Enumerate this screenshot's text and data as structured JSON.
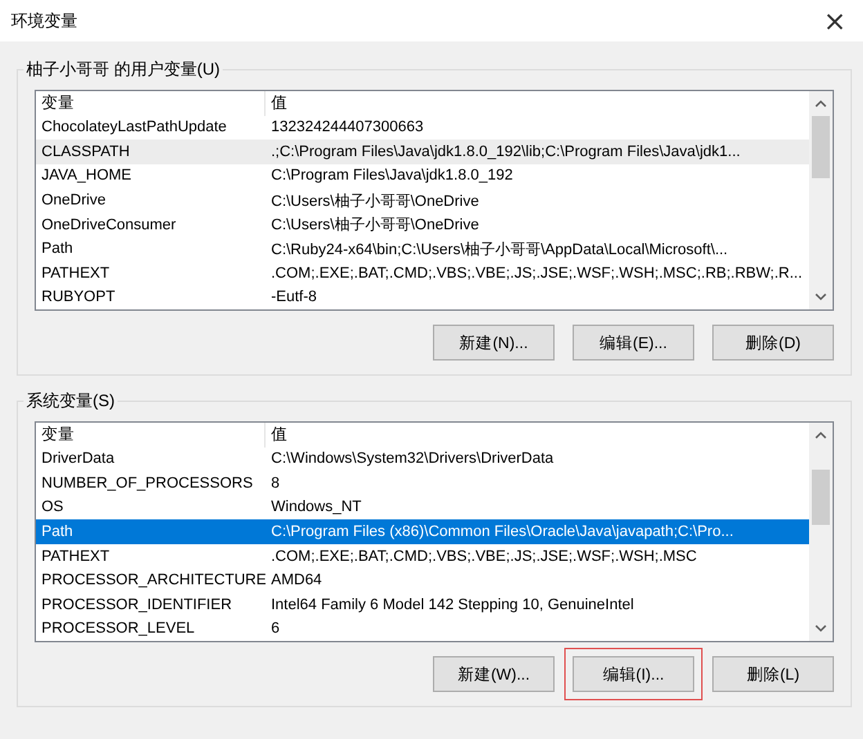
{
  "window": {
    "title": "环境变量",
    "close": "×"
  },
  "groups": [
    {
      "label": "柚子小哥哥 的用户变量(U)",
      "focused": false,
      "columns": [
        "变量",
        "值"
      ],
      "rows": [
        {
          "name": "ChocolateyLastPathUpdate",
          "value": "132324244407300663",
          "selected": false
        },
        {
          "name": "CLASSPATH",
          "value": ".;C:\\Program Files\\Java\\jdk1.8.0_192\\lib;C:\\Program Files\\Java\\jdk1...",
          "selected": true
        },
        {
          "name": "JAVA_HOME",
          "value": "C:\\Program Files\\Java\\jdk1.8.0_192",
          "selected": false
        },
        {
          "name": "OneDrive",
          "value": "C:\\Users\\柚子小哥哥\\OneDrive",
          "selected": false
        },
        {
          "name": "OneDriveConsumer",
          "value": "C:\\Users\\柚子小哥哥\\OneDrive",
          "selected": false
        },
        {
          "name": "Path",
          "value": "C:\\Ruby24-x64\\bin;C:\\Users\\柚子小哥哥\\AppData\\Local\\Microsoft\\...",
          "selected": false
        },
        {
          "name": "PATHEXT",
          "value": ".COM;.EXE;.BAT;.CMD;.VBS;.VBE;.JS;.JSE;.WSF;.WSH;.MSC;.RB;.RBW;.R...",
          "selected": false
        },
        {
          "name": "RUBYOPT",
          "value": "-Eutf-8",
          "selected": false
        }
      ],
      "buttons": [
        {
          "label": "新建(N)...",
          "highlighted": false
        },
        {
          "label": "编辑(E)...",
          "highlighted": false
        },
        {
          "label": "删除(D)",
          "highlighted": false
        }
      ]
    },
    {
      "label": "系统变量(S)",
      "focused": true,
      "columns": [
        "变量",
        "值"
      ],
      "rows": [
        {
          "name": "DriverData",
          "value": "C:\\Windows\\System32\\Drivers\\DriverData",
          "selected": false
        },
        {
          "name": "NUMBER_OF_PROCESSORS",
          "value": "8",
          "selected": false
        },
        {
          "name": "OS",
          "value": "Windows_NT",
          "selected": false
        },
        {
          "name": "Path",
          "value": "C:\\Program Files (x86)\\Common Files\\Oracle\\Java\\javapath;C:\\Pro...",
          "selected": true
        },
        {
          "name": "PATHEXT",
          "value": ".COM;.EXE;.BAT;.CMD;.VBS;.VBE;.JS;.JSE;.WSF;.WSH;.MSC",
          "selected": false
        },
        {
          "name": "PROCESSOR_ARCHITECTURE",
          "value": "AMD64",
          "selected": false
        },
        {
          "name": "PROCESSOR_IDENTIFIER",
          "value": "Intel64 Family 6 Model 142 Stepping 10, GenuineIntel",
          "selected": false
        },
        {
          "name": "PROCESSOR_LEVEL",
          "value": "6",
          "selected": false
        }
      ],
      "buttons": [
        {
          "label": "新建(W)...",
          "highlighted": false
        },
        {
          "label": "编辑(I)...",
          "highlighted": true
        },
        {
          "label": "删除(L)",
          "highlighted": false
        }
      ]
    }
  ]
}
